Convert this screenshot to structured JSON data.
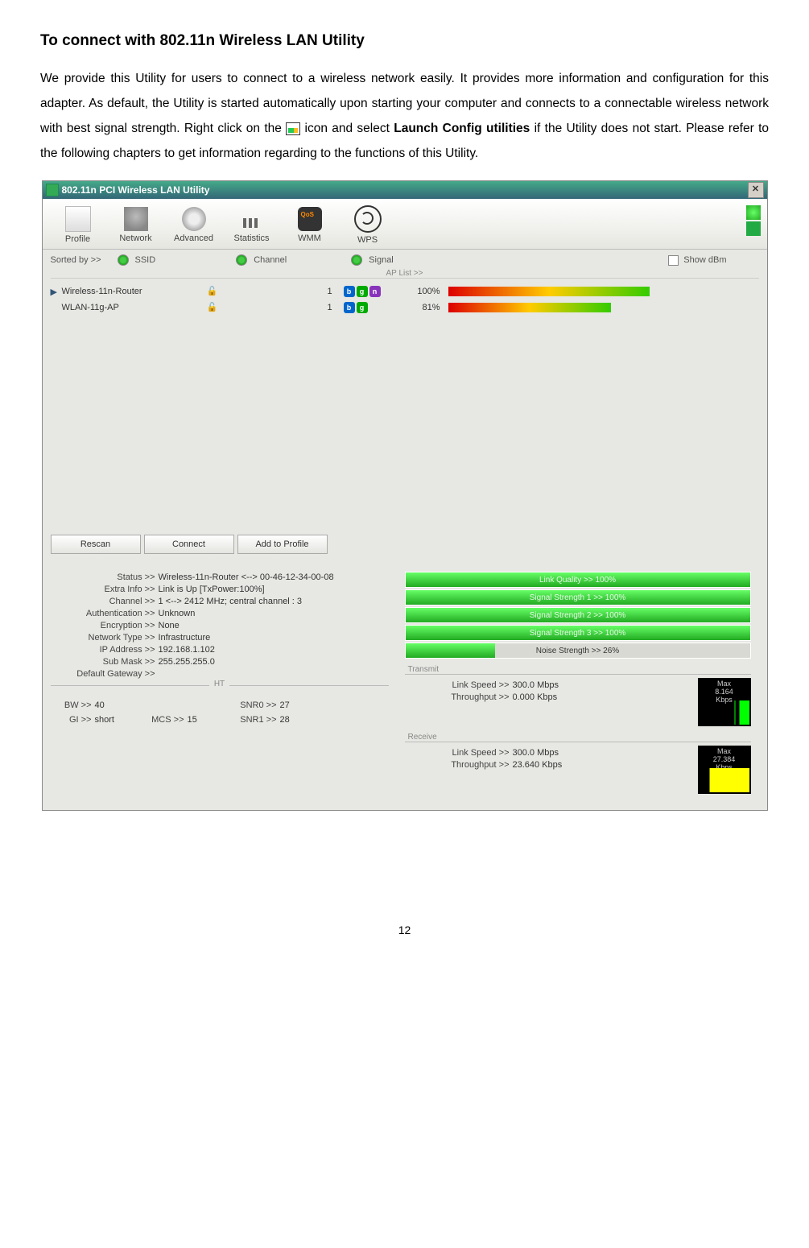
{
  "title": "To connect with 802.11n Wireless LAN Utility",
  "prose_before": "We provide this Utility for users to connect to a wireless network easily. It provides more information and configuration for this adapter. As default, the Utility is started automatically upon starting your computer and connects to a connectable wireless network with best signal strength. Right click on the ",
  "prose_mid": " icon and select ",
  "bold_phrase": "Launch Config utilities",
  "prose_after": " if the Utility does not start. Please refer to the following chapters to get information regarding to the functions of this Utility.",
  "window_title": "802.11n PCI Wireless LAN Utility",
  "toolbar": {
    "profile": "Profile",
    "network": "Network",
    "advanced": "Advanced",
    "statistics": "Statistics",
    "wmm": "WMM",
    "wps": "WPS"
  },
  "sort": {
    "label": "Sorted by >>",
    "ssid": "SSID",
    "channel": "Channel",
    "signal": "Signal",
    "show_dbm": "Show dBm"
  },
  "ap_list_label": "AP List >>",
  "aps": [
    {
      "name": "Wireless-11n-Router",
      "ch": "1",
      "pct": "100%",
      "bn": true,
      "width": "100%"
    },
    {
      "name": "WLAN-11g-AP",
      "ch": "1",
      "pct": "81%",
      "bn": false,
      "width": "81%"
    }
  ],
  "buttons": {
    "rescan": "Rescan",
    "connect": "Connect",
    "add": "Add to Profile"
  },
  "info": {
    "status_l": "Status >>",
    "status_v": "Wireless-11n-Router <--> 00-46-12-34-00-08",
    "extra_l": "Extra Info >>",
    "extra_v": "Link is Up [TxPower:100%]",
    "chan_l": "Channel >>",
    "chan_v": "1 <--> 2412 MHz; central channel : 3",
    "auth_l": "Authentication >>",
    "auth_v": "Unknown",
    "enc_l": "Encryption >>",
    "enc_v": "None",
    "net_l": "Network Type >>",
    "net_v": "Infrastructure",
    "ip_l": "IP Address >>",
    "ip_v": "192.168.1.102",
    "mask_l": "Sub Mask >>",
    "mask_v": "255.255.255.0",
    "gw_l": "Default Gateway >>",
    "gw_v": ""
  },
  "ht": {
    "hdr": "HT",
    "bw_l": "BW >>",
    "bw_v": "40",
    "gi_l": "GI >>",
    "gi_v": "short",
    "mcs_l": "MCS >>",
    "mcs_v": "15",
    "snr0_l": "SNR0 >>",
    "snr0_v": "27",
    "snr1_l": "SNR1 >>",
    "snr1_v": "28"
  },
  "meters": {
    "lq": "Link Quality >> 100%",
    "s1": "Signal Strength 1 >> 100%",
    "s2": "Signal Strength 2 >> 100%",
    "s3": "Signal Strength 3 >> 100%",
    "noise": "Noise Strength >> 26%"
  },
  "transmit": {
    "hdr": "Transmit",
    "ls_l": "Link Speed >>",
    "ls_v": "300.0 Mbps",
    "tp_l": "Throughput >>",
    "tp_v": "0.000 Kbps",
    "max": "Max",
    "maxv": "8.164",
    "unit": "Kbps"
  },
  "receive": {
    "hdr": "Receive",
    "ls_l": "Link Speed >>",
    "ls_v": "300.0 Mbps",
    "tp_l": "Throughput >>",
    "tp_v": "23.640 Kbps",
    "max": "Max",
    "maxv": "27.384",
    "unit": "Kbps"
  },
  "pagenum": "12"
}
